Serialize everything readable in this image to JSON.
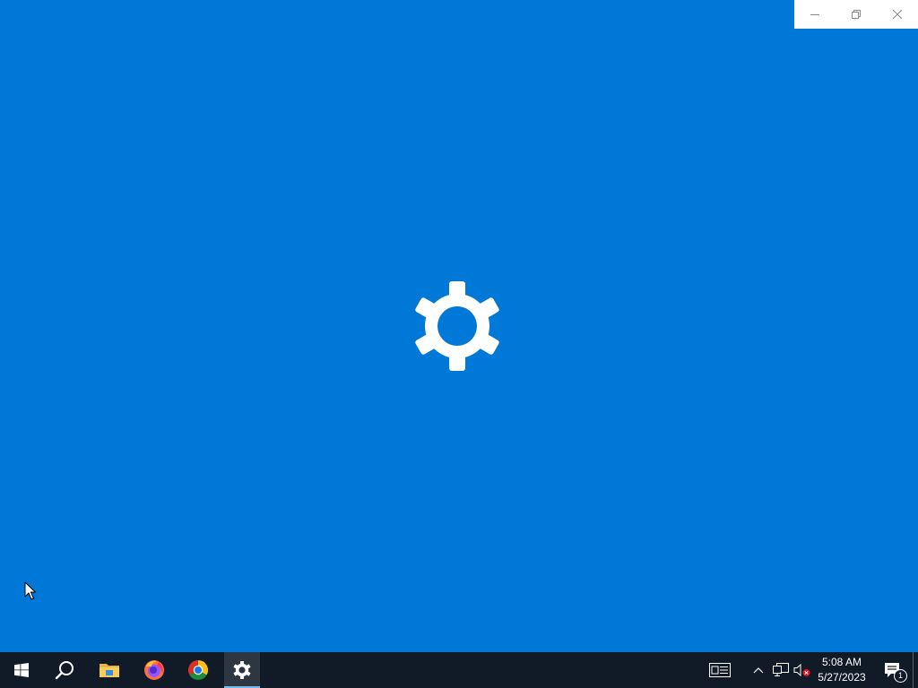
{
  "window": {
    "app": "Settings",
    "state": "loading",
    "caption_buttons": [
      "minimize",
      "restore",
      "close"
    ]
  },
  "splash": {
    "icon": "gear-icon",
    "background_color": "#0078d7",
    "icon_color": "#ffffff"
  },
  "taskbar": {
    "background_color": "#101b27",
    "pinned": [
      {
        "name": "start-button",
        "icon": "windows-logo-icon"
      },
      {
        "name": "search-button",
        "icon": "search-icon"
      },
      {
        "name": "file-explorer-button",
        "icon": "folder-icon"
      },
      {
        "name": "firefox-button",
        "icon": "firefox-icon"
      },
      {
        "name": "chrome-button",
        "icon": "chrome-icon"
      },
      {
        "name": "settings-button",
        "icon": "gear-icon",
        "active": true
      }
    ],
    "tray": {
      "news_icon": "news-icon",
      "chevron_icon": "chevron-up-icon",
      "network_icon": "network-icon",
      "volume_icon": "volume-muted-icon",
      "time": "5:08 AM",
      "date": "5/27/2023",
      "notifications_icon": "action-center-icon",
      "notification_count": "1"
    }
  }
}
